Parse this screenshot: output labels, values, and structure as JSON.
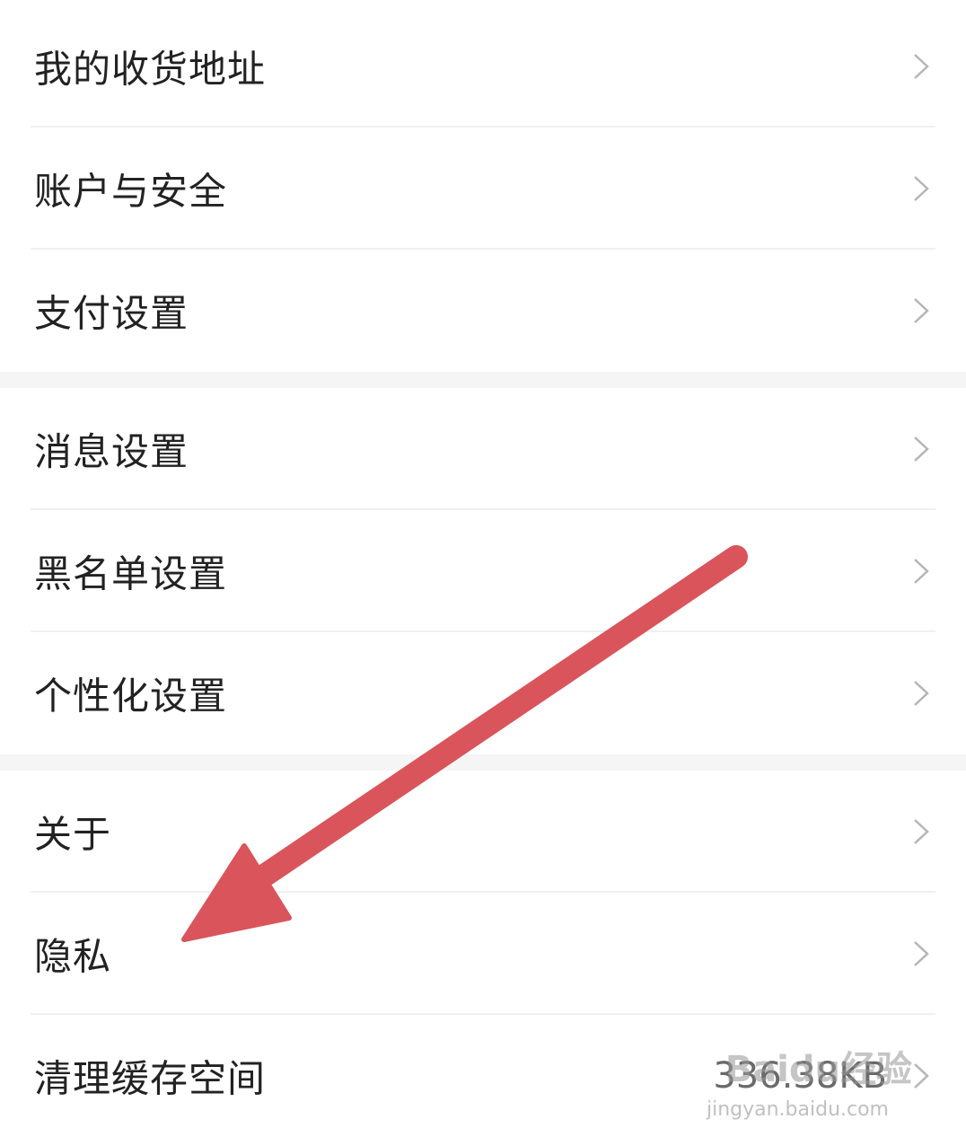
{
  "settings": {
    "groups": [
      {
        "items": [
          {
            "label": "我的收货地址"
          },
          {
            "label": "账户与安全"
          },
          {
            "label": "支付设置"
          }
        ]
      },
      {
        "items": [
          {
            "label": "消息设置"
          },
          {
            "label": "黑名单设置"
          },
          {
            "label": "个性化设置"
          }
        ]
      },
      {
        "items": [
          {
            "label": "关于"
          },
          {
            "label": "隐私"
          },
          {
            "label": "清理缓存空间",
            "value": "336.38KB"
          }
        ]
      }
    ]
  },
  "annotation": {
    "arrow_color": "#d9555b",
    "arrow_target": "隐私"
  },
  "watermark": {
    "brand": "Baidu经验",
    "url": "jingyan.baidu.com"
  },
  "icons": {
    "chevron": "chevron-right-icon"
  }
}
